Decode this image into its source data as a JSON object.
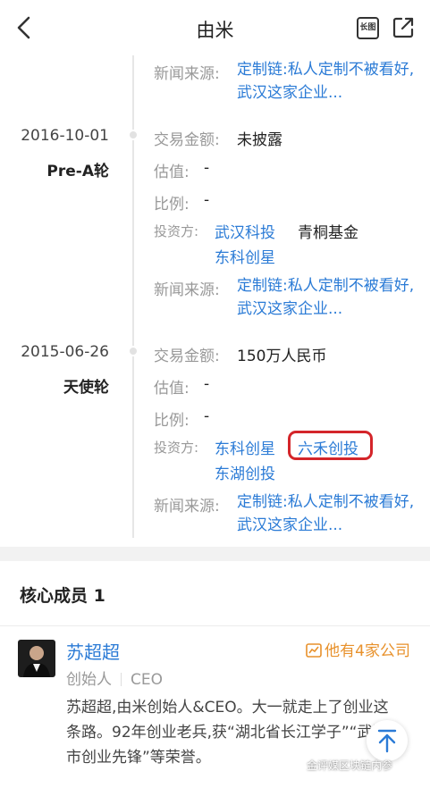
{
  "header": {
    "title": "由米",
    "long_image_label": "长图"
  },
  "rounds": [
    {
      "date": "",
      "round": "",
      "news_label": "新闻来源:",
      "news_text": "定制链:私人定制不被看好,武汉这家企业..."
    },
    {
      "date": "2016-10-01",
      "round": "Pre-A轮",
      "amount_label": "交易金额:",
      "amount": "未披露",
      "valuation_label": "估值:",
      "valuation": "-",
      "ratio_label": "比例:",
      "ratio": "-",
      "investors_label": "投资方:",
      "investors": [
        "武汉科投",
        "青桐基金",
        "东科创星"
      ],
      "news_label": "新闻来源:",
      "news_text": "定制链:私人定制不被看好,武汉这家企业..."
    },
    {
      "date": "2015-06-26",
      "round": "天使轮",
      "amount_label": "交易金额:",
      "amount": "150万人民币",
      "valuation_label": "估值:",
      "valuation": "-",
      "ratio_label": "比例:",
      "ratio": "-",
      "investors_label": "投资方:",
      "investors": [
        "东科创星",
        "六禾创投",
        "东湖创投"
      ],
      "news_label": "新闻来源:",
      "news_text": "定制链:私人定制不被看好,武汉这家企业..."
    }
  ],
  "members": {
    "title": "核心成员 1",
    "person": {
      "name": "苏超超",
      "other_companies": "他有4家公司",
      "role": "创始人",
      "title": "CEO",
      "bio": "苏超超,由米创始人&CEO。大一就走上了创业这条路。92年创业老兵,获“湖北省长江学子”“武汉市创业先锋”等荣誉。"
    }
  },
  "watermark": "金评媒区块链内参",
  "colors": {
    "link": "#2b7bd6",
    "highlight_border": "#d4252a",
    "company_link": "#e8912b"
  }
}
